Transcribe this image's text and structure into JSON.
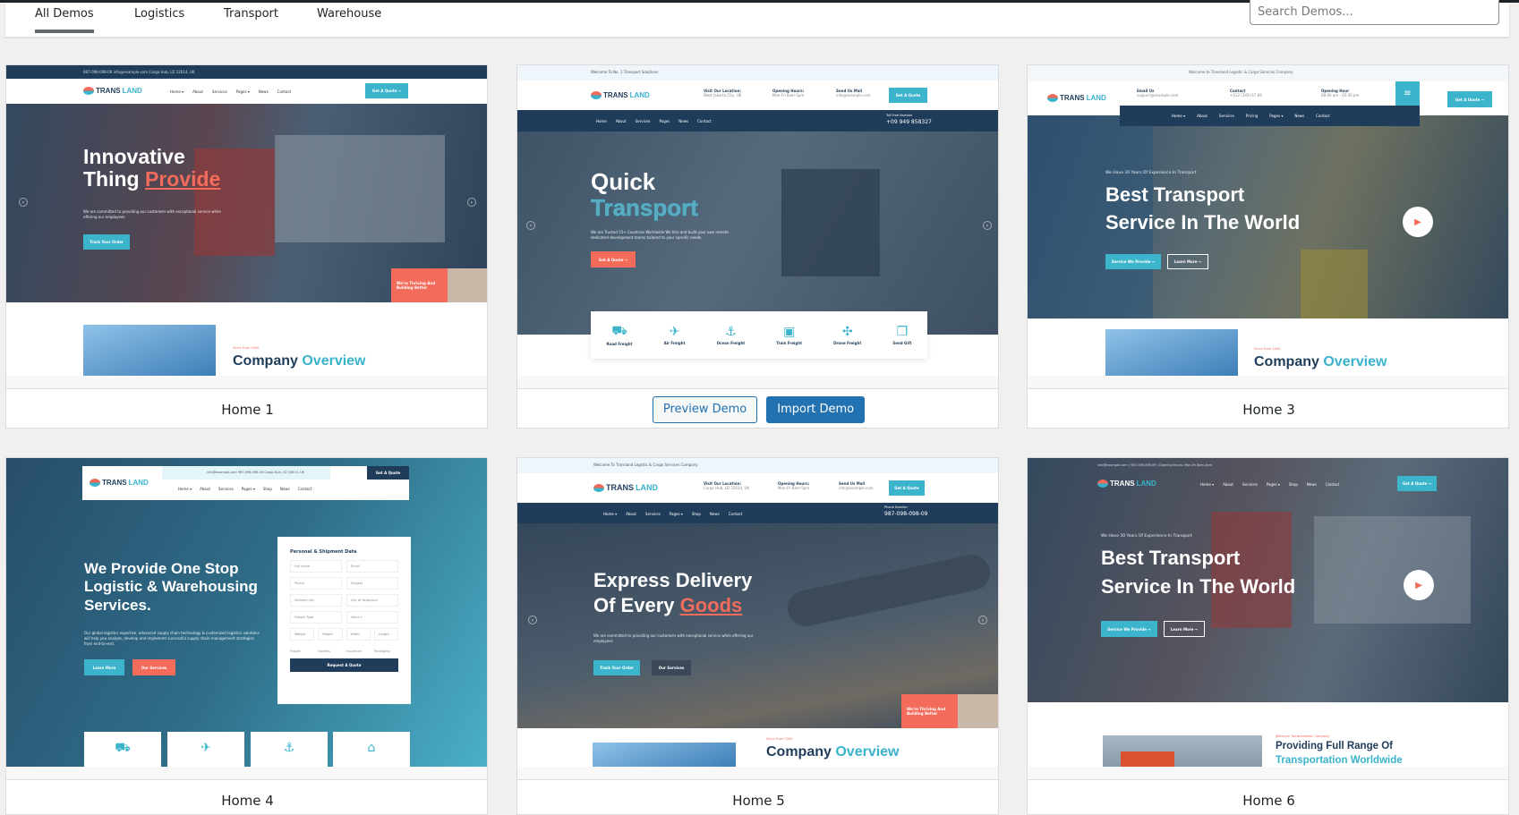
{
  "tabs": [
    {
      "label": "All Demos",
      "active": true
    },
    {
      "label": "Logistics"
    },
    {
      "label": "Transport"
    },
    {
      "label": "Warehouse"
    }
  ],
  "search": {
    "placeholder": "Search Demos..."
  },
  "colors": {
    "accent": "#2271b1",
    "brand_teal": "#3cb4cc",
    "brand_coral": "#f26b5b",
    "brand_navy": "#1f3d5a"
  },
  "buttons": {
    "preview": "Preview Demo",
    "import": "Import Demo"
  },
  "demos": [
    {
      "name": "Home 1",
      "logo": "TRANS",
      "logo2": "LAND",
      "nav": [
        "Home ▾",
        "About",
        "Services",
        "Pages ▾",
        "News",
        "Contact"
      ],
      "topbar": "987-098-098-09    info@example.com    Cargo Hub, LD 32614, UK",
      "quote": "Get A Quote →",
      "h1a": "Innovative",
      "h1b": "Thing ",
      "h1acc": "Provide",
      "p": "We are committed to providing our customers with exceptional service while offering our employees",
      "btn": "Track Your Order",
      "badge": "We're Thriving And Building Better",
      "since": "Since From 2000",
      "co1": "Company ",
      "co2": "Overview"
    },
    {
      "name": "Home 2",
      "topbar": "Welcome To No. 1 Transport Solutions",
      "info": [
        {
          "t": "Visit Our Location:",
          "s": "West Jakarta City, UK"
        },
        {
          "t": "Opening Hours:",
          "s": "Mon-Fri 8am-5pm"
        },
        {
          "t": "Send Us Mail",
          "s": "info@example.com"
        }
      ],
      "quote": "Get A Quote",
      "nav": [
        "Home",
        "About",
        "Services",
        "Pages",
        "News",
        "Contact"
      ],
      "toll_label": "Toll Free Number",
      "toll": "+09 949 858327",
      "h1a": "Quick",
      "h1b": "Transport",
      "p": "We are Trusted 15+ Countries Worldwide We hire and build your own remote dedicated development teams tailored to your specific needs.",
      "btn": "Get A Quote →",
      "services": [
        "Road Freight",
        "Air Freight",
        "Ocean Freight",
        "Train Freight",
        "Drone Freight",
        "Send Gift"
      ]
    },
    {
      "name": "Home 3",
      "topbar": "Welcome to Transland Logistic & Cargo Services Company",
      "info": [
        {
          "t": "Email Us",
          "s": "support@example.com"
        },
        {
          "t": "Contact",
          "s": "+012 (345) 67 89"
        },
        {
          "t": "Opening Hour",
          "s": "08:00 am - 05:00 pm"
        }
      ],
      "quote": "Get A Quote →",
      "nav": [
        "Home ▾",
        "About",
        "Services",
        "Pricing",
        "Pages ▾",
        "News",
        "Contact"
      ],
      "tag": "We Have 30 Years Of Experience In Transport",
      "h1a": "Best Transport",
      "h1b": "Service In The World",
      "btn1": "Service We Provide →",
      "btn2": "Learn More →",
      "since": "Since From 2000",
      "co1": "Company ",
      "co2": "Overview"
    },
    {
      "name": "Home 4",
      "topbar": "info@example.com    987-098-098-09    Cargo Hub, LD 32614, UK",
      "quote": "Get A Quote",
      "nav": [
        "Home ▾",
        "About",
        "Services",
        "Pages ▾",
        "Shop",
        "News",
        "Contact"
      ],
      "h1": [
        "We Provide One Stop",
        "Logistic & Warehousing",
        "Services."
      ],
      "p": "Our global logistics expertise, advanced supply chain technology & customized logistics solutions will help you analyze, develop and implement successful supply chain management strategies from end-to-end.",
      "btn1": "Learn More",
      "btn2": "Our Services",
      "form_title": "Personal & Shipment Data",
      "fields": [
        "Full name",
        "Email",
        "Phone",
        "Subject",
        "Delivery city",
        "City of departure",
        "Freight Type",
        "Value 1"
      ],
      "dims": [
        "Weight",
        "Height",
        "Width",
        "Length"
      ],
      "checks": [
        "Fragile",
        "Express",
        "Insurance",
        "Packaging"
      ],
      "submit": "Request A Quote"
    },
    {
      "name": "Home 5",
      "topbar": "Welcome To Transland Logistic & Cargo Services Company",
      "info": [
        {
          "t": "Visit Our Location:",
          "s": "Cargo Hub, LD 32614, UK"
        },
        {
          "t": "Opening Hours:",
          "s": "Mon-Fri 8am-5pm"
        },
        {
          "t": "Send Us Mail",
          "s": "info@example.com"
        }
      ],
      "quote": "Get A Quote",
      "nav": [
        "Home ▾",
        "About",
        "Services",
        "Pages ▾",
        "Shop",
        "News",
        "Contact"
      ],
      "phone_label": "Phone Number",
      "phone": "987-098-098-09",
      "h1a": "Express Delivery",
      "h1b": "Of Every ",
      "h1acc": "Goods",
      "p": "We are committed to providing our customers with exceptional service while offering our employees",
      "btn1": "Track Your Order",
      "btn2": "Our Services",
      "badge": "We're Thriving And Building Better",
      "since": "Since From 2000",
      "co1": "Company ",
      "co2": "Overview"
    },
    {
      "name": "Home 6",
      "topbar": "info@example.com  |  987-098-098-09  |  Opening Hours: Mon-Fri 8am-5pm",
      "quote": "Get A Quote →",
      "nav": [
        "Home ▾",
        "About",
        "Services",
        "Pages ▾",
        "Shop",
        "News",
        "Contact"
      ],
      "tag": "We Have 30 Years Of Experience In Transport",
      "h1a": "Best Transport",
      "h1b": "Service In The World",
      "btn1": "Service We Provide →",
      "btn2": "Learn More →",
      "since": "Welcome Transportation Company",
      "co1": "Providing Full Range Of",
      "co2": "Transportation Worldwide"
    }
  ]
}
